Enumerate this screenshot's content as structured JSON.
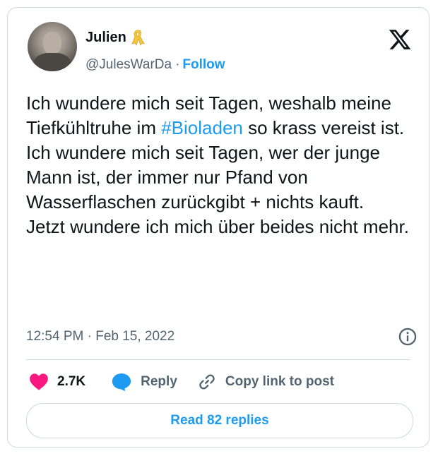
{
  "author": {
    "name": "Julien",
    "handle": "@JulesWarDa",
    "separator": "·",
    "follow_label": "Follow"
  },
  "tweet": {
    "text_before_hashtag": "Ich wundere mich seit Tagen, weshalb meine Tiefkühltruhe im ",
    "hashtag": "#Bioladen",
    "text_after_hashtag": " so krass vereist ist.",
    "line2": "Ich wundere mich seit Tagen, wer der junge Mann ist, der immer nur Pfand von Wasserflaschen zurückgibt + nichts kauft.",
    "line3": "Jetzt wundere ich mich über beides nicht mehr."
  },
  "meta": {
    "timestamp": "12:54 PM · Feb 15, 2022"
  },
  "actions": {
    "like_count": "2.7K",
    "reply_label": "Reply",
    "copy_link_label": "Copy link to post"
  },
  "footer": {
    "read_replies_label": "Read 82 replies"
  },
  "colors": {
    "accent": "#1d9bf0",
    "like": "#f91880",
    "ribbon": "#f5c542",
    "text_secondary": "#536471",
    "border": "#cfd9de"
  },
  "icons": {
    "ribbon": "yellow-ribbon-icon",
    "brand": "x-logo-icon",
    "info": "info-icon",
    "like": "heart-icon",
    "reply": "speech-bubble-icon",
    "copy_link": "link-icon"
  }
}
